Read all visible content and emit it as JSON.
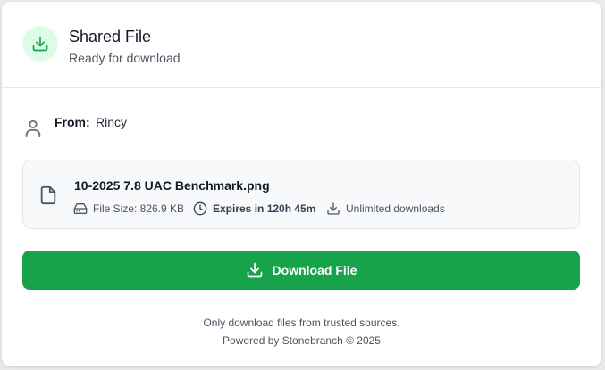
{
  "header": {
    "title": "Shared File",
    "subtitle": "Ready for download",
    "icon": "download-icon"
  },
  "sender": {
    "label": "From:",
    "name": "Rincy",
    "icon": "user-icon"
  },
  "file": {
    "name": "10-2025 7.8 UAC Benchmark.png",
    "icon": "file-icon",
    "size_text": "File Size: 826.9 KB",
    "expires_text": "Expires in 120h 45m",
    "downloads_text": "Unlimited downloads"
  },
  "action": {
    "download_label": "Download File"
  },
  "footer": {
    "warning": "Only download files from trusted sources.",
    "powered_by": "Powered by Stonebranch © 2025"
  },
  "colors": {
    "accent": "#16a34a",
    "accent_light": "#dcfce7",
    "text_primary": "#111827",
    "text_secondary": "#4b5563"
  }
}
